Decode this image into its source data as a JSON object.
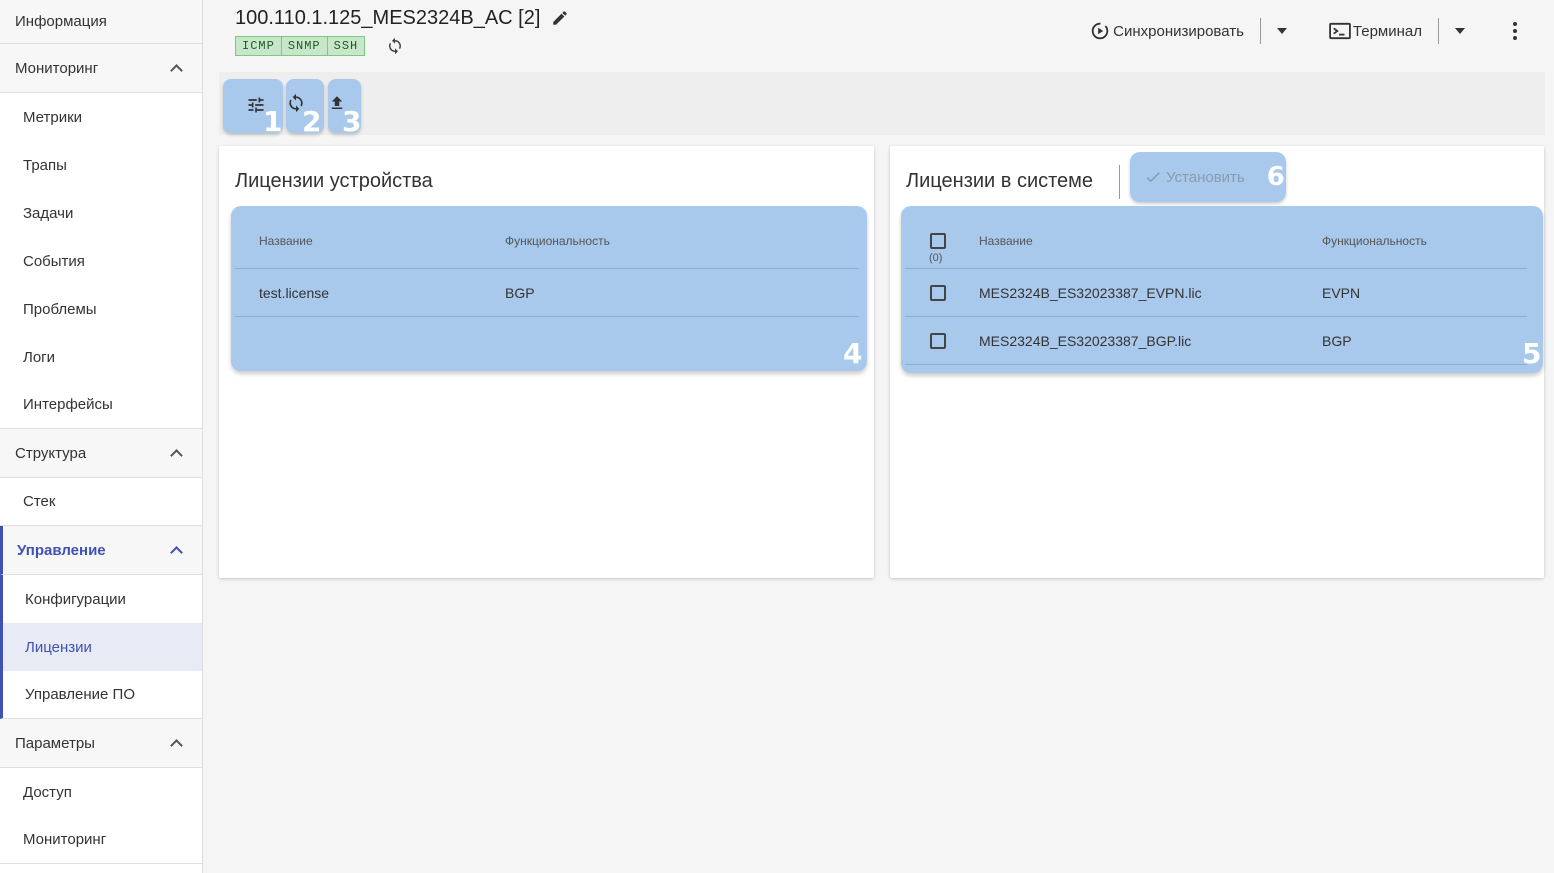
{
  "sidebar": {
    "info": "Информация",
    "monitoring": {
      "label": "Мониторинг",
      "items": [
        "Метрики",
        "Трапы",
        "Задачи",
        "События",
        "Проблемы",
        "Логи",
        "Интерфейсы"
      ]
    },
    "structure": {
      "label": "Структура",
      "items": [
        "Стек"
      ]
    },
    "management": {
      "label": "Управление",
      "items": [
        "Конфигурации",
        "Лицензии",
        "Управление ПО"
      ],
      "selected": "Лицензии"
    },
    "parameters": {
      "label": "Параметры",
      "items": [
        "Доступ",
        "Мониторинг"
      ]
    }
  },
  "header": {
    "title": "100.110.1.125_MES2324B_AC [2]",
    "tags": [
      "ICMP",
      "SNMP",
      "SSH"
    ],
    "sync_label": "Синхронизировать",
    "terminal_label": "Терминал"
  },
  "toolbar": {
    "numbers": [
      "1",
      "2",
      "3"
    ]
  },
  "device_licenses": {
    "title": "Лицензии устройства",
    "columns": [
      "Название",
      "Функциональность"
    ],
    "rows": [
      {
        "name": "test.license",
        "function": "BGP"
      }
    ],
    "number": "4"
  },
  "system_licenses": {
    "title": "Лицензии в системе",
    "install_label": "Установить",
    "install_number": "6",
    "select_count": "(0)",
    "columns": [
      "Название",
      "Функциональность"
    ],
    "rows": [
      {
        "name": "MES2324B_ES32023387_EVPN.lic",
        "function": "EVPN"
      },
      {
        "name": "MES2324B_ES32023387_BGP.lic",
        "function": "BGP"
      }
    ],
    "number": "5"
  },
  "colors": {
    "accent": "#3f51b5",
    "highlight": "#a8c8ec",
    "tag_bg": "#c8e6c9"
  }
}
